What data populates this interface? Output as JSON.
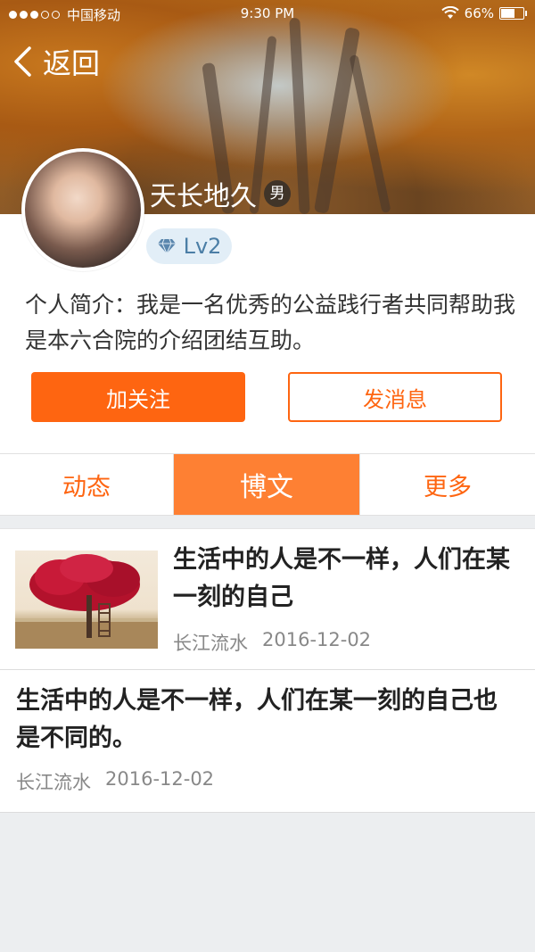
{
  "status_bar": {
    "carrier": "中国移动",
    "time": "9:30 PM",
    "battery": "66%",
    "battery_level": 0.66,
    "signal_bars_filled": 3,
    "signal_bars_total": 5
  },
  "header": {
    "back_label": "返回"
  },
  "profile": {
    "name": "天长地久",
    "gender": "男",
    "level": "Lv2",
    "bio": "个人简介：我是一名优秀的公益践行者共同帮助我是本六合院的介绍团结互助。"
  },
  "actions": {
    "follow_label": "加关注",
    "message_label": "发消息"
  },
  "tabs": [
    {
      "label": "动态",
      "active": false
    },
    {
      "label": "博文",
      "active": true
    },
    {
      "label": "更多",
      "active": false
    }
  ],
  "posts": [
    {
      "title": "生活中的人是不一样，人们在某一刻的自己",
      "author": "长江流水",
      "date": "2016-12-02",
      "has_thumbnail": true
    },
    {
      "title": "生活中的人是不一样，人们在某一刻的自己也是不同的。",
      "author": "长江流水",
      "date": "2016-12-02",
      "has_thumbnail": false
    }
  ],
  "colors": {
    "accent": "#fe6511",
    "tab_active": "#fe8033",
    "level_badge_bg": "#e2eef7",
    "level_badge_text": "#4b7ea6"
  }
}
